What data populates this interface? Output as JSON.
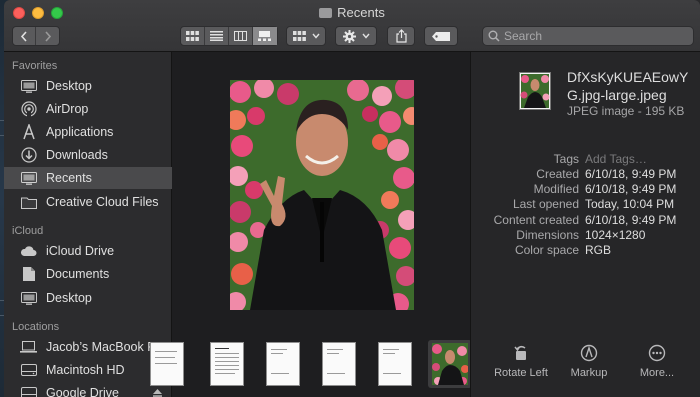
{
  "window": {
    "title": "Recents"
  },
  "toolbar": {
    "search_placeholder": "Search"
  },
  "sidebar": {
    "favorites_header": "Favorites",
    "favorites": [
      {
        "label": "Desktop",
        "icon": "desktop-icon"
      },
      {
        "label": "AirDrop",
        "icon": "airdrop-icon"
      },
      {
        "label": "Applications",
        "icon": "applications-icon"
      },
      {
        "label": "Downloads",
        "icon": "downloads-icon"
      },
      {
        "label": "Recents",
        "icon": "recents-icon",
        "selected": true
      },
      {
        "label": "Creative Cloud Files",
        "icon": "folder-icon"
      }
    ],
    "icloud_header": "iCloud",
    "icloud": [
      {
        "label": "iCloud Drive",
        "icon": "cloud-icon"
      },
      {
        "label": "Documents",
        "icon": "documents-icon"
      },
      {
        "label": "Desktop",
        "icon": "desktop-icon"
      }
    ],
    "locations_header": "Locations",
    "locations": [
      {
        "label": "Jacob’s MacBook Pro",
        "icon": "laptop-icon"
      },
      {
        "label": "Macintosh HD",
        "icon": "disk-icon"
      },
      {
        "label": "Google Drive",
        "icon": "disk-icon"
      }
    ]
  },
  "info": {
    "file_name": "DfXsKyKUEAEowYG.jpg-large.jpeg",
    "file_meta": "JPEG image - 195 KB",
    "rows": [
      {
        "key": "Tags",
        "value": "Add Tags…",
        "placeholder": true
      },
      {
        "key": "Created",
        "value": "6/10/18, 9:49 PM"
      },
      {
        "key": "Modified",
        "value": "6/10/18, 9:49 PM"
      },
      {
        "key": "Last opened",
        "value": "Today, 10:04 PM"
      },
      {
        "key": "Content created",
        "value": "6/10/18, 9:49 PM"
      },
      {
        "key": "Dimensions",
        "value": "1024×1280"
      },
      {
        "key": "Color space",
        "value": "RGB"
      }
    ]
  },
  "quick_actions": [
    {
      "label": "Rotate Left",
      "icon": "rotate-left-icon"
    },
    {
      "label": "Markup",
      "icon": "markup-icon"
    },
    {
      "label": "More...",
      "icon": "more-icon"
    }
  ],
  "colors": {
    "sidebar_bg": "#2c2c2e",
    "selection": "#4a4a4c",
    "window_bg": "#1f1f21"
  }
}
